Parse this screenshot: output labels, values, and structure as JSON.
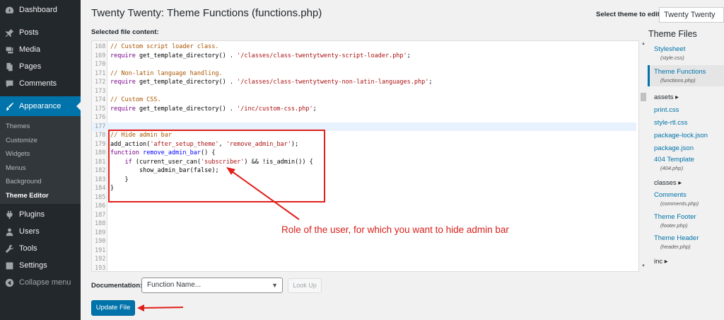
{
  "sidebar": {
    "items": [
      {
        "label": "Dashboard",
        "icon": "dashboard-icon"
      },
      {
        "label": "Posts",
        "icon": "pin-icon"
      },
      {
        "label": "Media",
        "icon": "media-icon"
      },
      {
        "label": "Pages",
        "icon": "pages-icon"
      },
      {
        "label": "Comments",
        "icon": "comments-icon"
      },
      {
        "label": "Appearance",
        "icon": "brush-icon"
      },
      {
        "label": "Plugins",
        "icon": "plugin-icon"
      },
      {
        "label": "Users",
        "icon": "users-icon"
      },
      {
        "label": "Tools",
        "icon": "wrench-icon"
      },
      {
        "label": "Settings",
        "icon": "settings-icon"
      },
      {
        "label": "Collapse menu",
        "icon": "collapse-icon"
      }
    ],
    "submenu": [
      "Themes",
      "Customize",
      "Widgets",
      "Menus",
      "Background",
      "Theme Editor"
    ]
  },
  "header": {
    "title": "Twenty Twenty: Theme Functions (functions.php)",
    "select_theme_label": "Select theme to edit:",
    "selected_theme": "Twenty Twenty"
  },
  "editor": {
    "label": "Selected file content:",
    "lines": [
      {
        "n": "168",
        "text": "// Custom script loader class."
      },
      {
        "n": "169",
        "text": "require get_template_directory() . '/classes/class-twentytwenty-script-loader.php';"
      },
      {
        "n": "170",
        "text": ""
      },
      {
        "n": "171",
        "text": "// Non-latin language handling."
      },
      {
        "n": "172",
        "text": "require get_template_directory() . '/classes/class-twentytwenty-non-latin-languages.php';"
      },
      {
        "n": "173",
        "text": ""
      },
      {
        "n": "174",
        "text": "// Custom CSS."
      },
      {
        "n": "175",
        "text": "require get_template_directory() . '/inc/custom-css.php';"
      },
      {
        "n": "176",
        "text": ""
      },
      {
        "n": "177",
        "text": ""
      },
      {
        "n": "178",
        "text": "// Hide admin bar"
      },
      {
        "n": "179",
        "text": "add_action('after_setup_theme', 'remove_admin_bar');"
      },
      {
        "n": "180",
        "text": "function remove_admin_bar() {"
      },
      {
        "n": "181",
        "text": "    if (current_user_can('subscriber') && !is_admin()) {"
      },
      {
        "n": "182",
        "text": "        show_admin_bar(false);"
      },
      {
        "n": "183",
        "text": "    }"
      },
      {
        "n": "184",
        "text": "}"
      },
      {
        "n": "185",
        "text": ""
      },
      {
        "n": "186",
        "text": ""
      },
      {
        "n": "187",
        "text": ""
      },
      {
        "n": "188",
        "text": ""
      },
      {
        "n": "189",
        "text": ""
      },
      {
        "n": "190",
        "text": ""
      },
      {
        "n": "191",
        "text": ""
      },
      {
        "n": "192",
        "text": ""
      },
      {
        "n": "193",
        "text": ""
      }
    ]
  },
  "annotation": "Role of the user, for which you want to hide admin bar",
  "theme_files": {
    "title": "Theme Files",
    "entries": [
      {
        "label": "Stylesheet",
        "sub": "(style.css)"
      },
      {
        "label": "Theme Functions",
        "sub": "(functions.php)"
      },
      {
        "label": "assets ▸"
      },
      {
        "label": "print.css"
      },
      {
        "label": "style-rtl.css"
      },
      {
        "label": "package-lock.json"
      },
      {
        "label": "package.json"
      },
      {
        "label": "404 Template",
        "sub": "(404.php)"
      },
      {
        "label": "classes ▸"
      },
      {
        "label": "Comments",
        "sub": "(comments.php)"
      },
      {
        "label": "Theme Footer",
        "sub": "(footer.php)"
      },
      {
        "label": "Theme Header",
        "sub": "(header.php)"
      },
      {
        "label": "inc ▸"
      }
    ]
  },
  "bottom": {
    "documentation_label": "Documentation:",
    "function_placeholder": "Function Name...",
    "lookup_label": "Look Up",
    "update_label": "Update File"
  },
  "colors": {
    "accent": "#0073aa",
    "sidebar": "#23282d",
    "annotation": "#e0201b"
  }
}
